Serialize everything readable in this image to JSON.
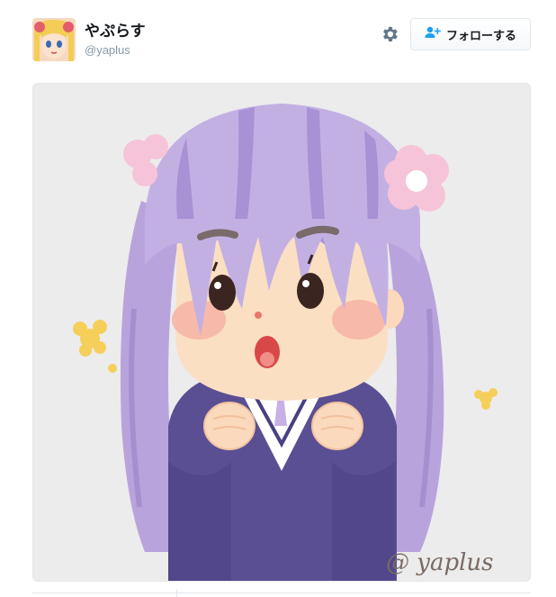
{
  "profile": {
    "display_name": "やぷらす",
    "handle": "@yaplus"
  },
  "actions": {
    "follow_label": "フォローする",
    "settings_icon": "gear-icon",
    "follow_icon": "add-user-icon"
  },
  "media": {
    "signature_text": "@ yaplus"
  },
  "colors": {
    "accent": "#1da1f2",
    "muted": "#8899a6",
    "hair": "#b7a3d9",
    "jacket": "#5a4f93"
  }
}
